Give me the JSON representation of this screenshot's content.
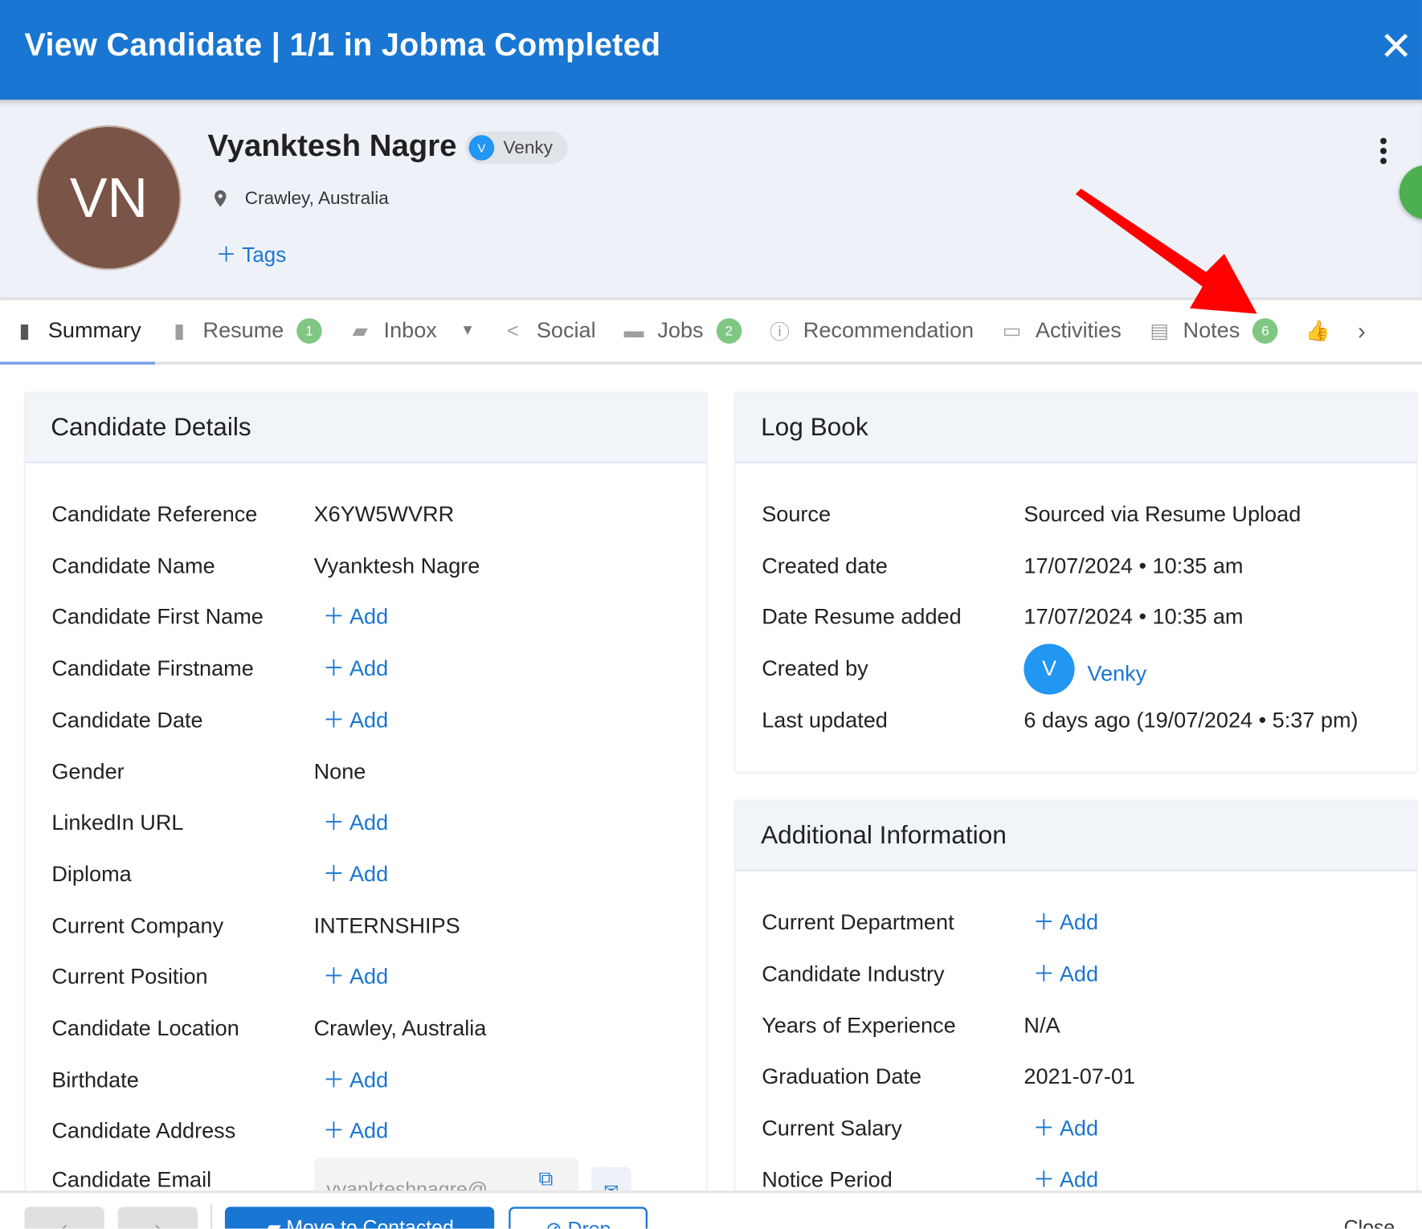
{
  "header": {
    "title": "View Candidate | 1/1 in Jobma Completed",
    "close_icon": "close-icon"
  },
  "profile": {
    "initials": "VN",
    "avatar_color": "#7a5446",
    "name": "Vyanktesh Nagre",
    "owner_initial": "V",
    "owner": "Venky",
    "location": "Crawley, Australia",
    "tags_label": "Tags"
  },
  "tabs": [
    {
      "label": "Summary",
      "icon": "book-icon",
      "active": true
    },
    {
      "label": "Resume",
      "icon": "file-icon",
      "badge": "1"
    },
    {
      "label": "Inbox",
      "icon": "chat-icon",
      "dropdown": true
    },
    {
      "label": "Social",
      "icon": "share-icon"
    },
    {
      "label": "Jobs",
      "icon": "briefcase-icon",
      "badge": "2"
    },
    {
      "label": "Recommendation",
      "icon": "info-icon"
    },
    {
      "label": "Activities",
      "icon": "calendar-icon"
    },
    {
      "label": "Notes",
      "icon": "message-icon",
      "badge": "6"
    }
  ],
  "candidate_details": {
    "title": "Candidate Details",
    "rows": [
      {
        "label": "Candidate Reference",
        "value": "X6YW5WVRR"
      },
      {
        "label": "Candidate Name",
        "value": "Vyanktesh Nagre"
      },
      {
        "label": "Candidate First Name",
        "value": "Add",
        "add": true
      },
      {
        "label": "Candidate Firstname",
        "value": "Add",
        "add": true
      },
      {
        "label": "Candidate Date",
        "value": "Add",
        "add": true
      },
      {
        "label": "Gender",
        "value": "None"
      },
      {
        "label": "LinkedIn URL",
        "value": "Add",
        "add": true
      },
      {
        "label": "Diploma",
        "value": "Add",
        "add": true
      },
      {
        "label": "Current Company",
        "value": "INTERNSHIPS"
      },
      {
        "label": "Current Position",
        "value": "Add",
        "add": true
      },
      {
        "label": "Candidate Location",
        "value": "Crawley, Australia"
      },
      {
        "label": "Birthdate",
        "value": "Add",
        "add": true
      },
      {
        "label": "Candidate Address",
        "value": "Add",
        "add": true
      },
      {
        "label": "Candidate Email",
        "value": "vyankteshnagre@..."
      }
    ]
  },
  "log_book": {
    "title": "Log Book",
    "rows": [
      {
        "label": "Source",
        "value": "Sourced via Resume Upload"
      },
      {
        "label": "Created date",
        "value": "17/07/2024 • 10:35 am"
      },
      {
        "label": "Date Resume added",
        "value": "17/07/2024 • 10:35 am"
      },
      {
        "label": "Created by",
        "value": "Venky",
        "initial": "V"
      },
      {
        "label": "Last updated",
        "value": "6 days ago (19/07/2024 • 5:37 pm)"
      }
    ]
  },
  "additional_info": {
    "title": "Additional Information",
    "rows": [
      {
        "label": "Current Department",
        "value": "Add",
        "add": true
      },
      {
        "label": "Candidate Industry",
        "value": "Add",
        "add": true
      },
      {
        "label": "Years of Experience",
        "value": "N/A"
      },
      {
        "label": "Graduation Date",
        "value": "2021-07-01"
      },
      {
        "label": "Current Salary",
        "value": "Add",
        "add": true
      },
      {
        "label": "Notice Period",
        "value": "Add",
        "add": true
      }
    ]
  },
  "footer": {
    "move_label": "Move to Contacted",
    "drop_label": "Drop",
    "close_label": "Close"
  },
  "colors": {
    "primary": "#1976d2",
    "badge": "#81c784",
    "annotation_arrow": "#ff0000"
  }
}
